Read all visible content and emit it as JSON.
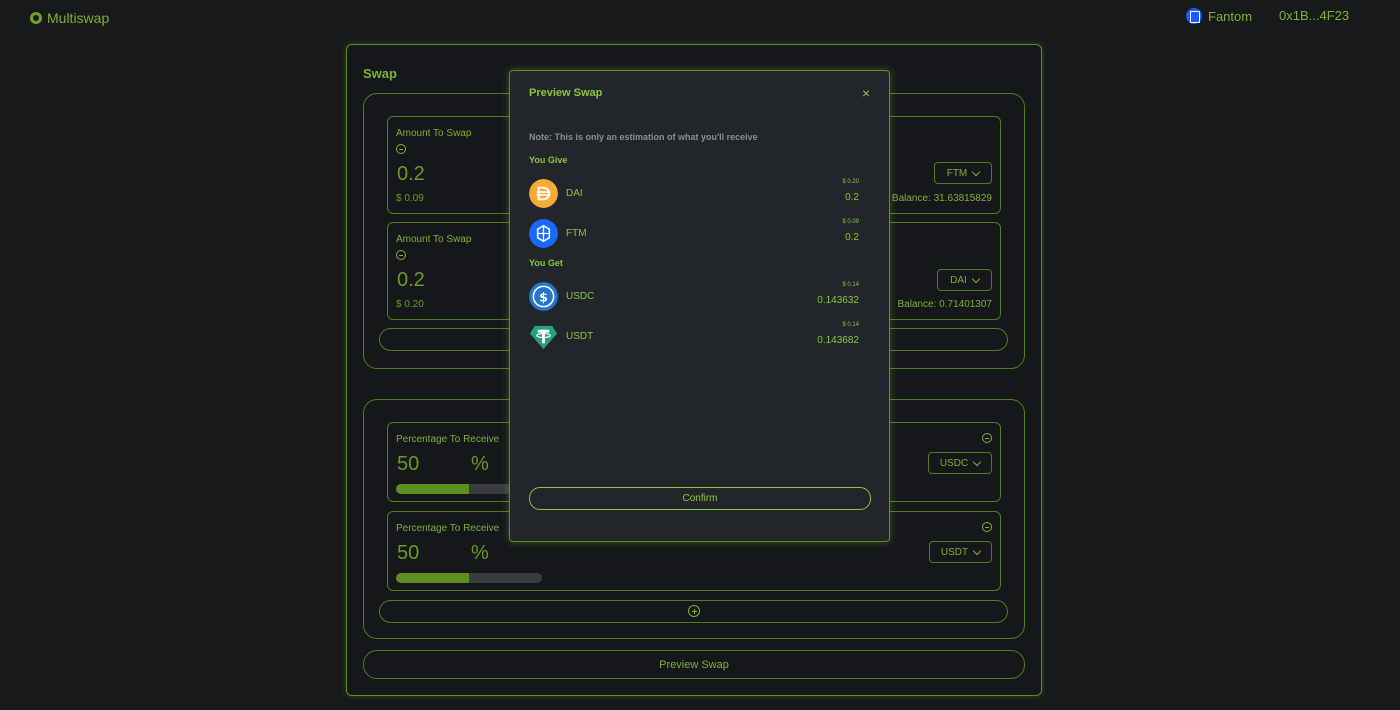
{
  "header": {
    "brand": "Multiswap",
    "network": "Fantom",
    "wallet": "0x1B...4F23"
  },
  "panel": {
    "title": "Swap",
    "give_cards": [
      {
        "label": "Amount To Swap",
        "value": "0.2",
        "usd": "$ 0.09",
        "token": "FTM",
        "balance": "Balance: 31.63815829"
      },
      {
        "label": "Amount To Swap",
        "value": "0.2",
        "usd": "$ 0.20",
        "token": "DAI",
        "balance": "Balance: 0.71401307"
      }
    ],
    "get_cards": [
      {
        "label": "Percentage To Receive",
        "value": "50",
        "unit": "%",
        "token": "USDC",
        "progress": 0.5
      },
      {
        "label": "Percentage To Receive",
        "value": "50",
        "unit": "%",
        "token": "USDT",
        "progress": 0.5
      }
    ],
    "preview_label": "Preview Swap"
  },
  "modal": {
    "title": "Preview Swap",
    "close": "×",
    "note": "Note: This is only an estimation of what you'll receive",
    "give_heading": "You Give",
    "get_heading": "You Get",
    "give": [
      {
        "name": "DAI",
        "usd": "$ 0.20",
        "amount": "0.2",
        "icon": "dai-icon",
        "color": "#f5ac37"
      },
      {
        "name": "FTM",
        "usd": "$ 0.09",
        "amount": "0.2",
        "icon": "ftm-icon",
        "color": "#1969ff"
      }
    ],
    "get": [
      {
        "name": "USDC",
        "usd": "$ 0.14",
        "amount": "0.143632",
        "icon": "usdc-icon",
        "color": "#2775ca"
      },
      {
        "name": "USDT",
        "usd": "$ 0.14",
        "amount": "0.143682",
        "icon": "usdt-icon",
        "color": "#26a17b"
      }
    ],
    "confirm_label": "Confirm"
  }
}
